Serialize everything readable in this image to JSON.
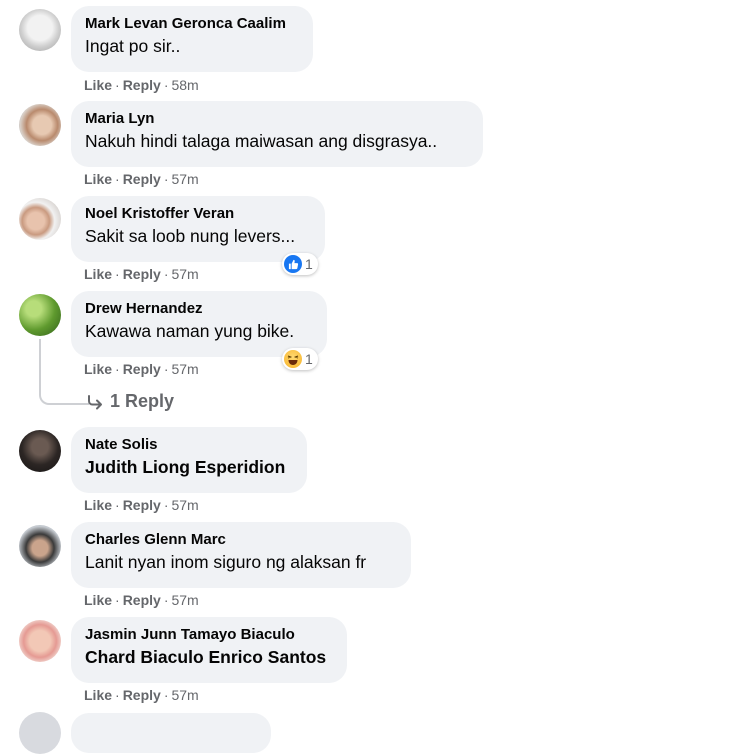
{
  "actions": {
    "like": "Like",
    "reply": "Reply",
    "sep": "·"
  },
  "comments": [
    {
      "author": "Mark Levan Geronca Caalim",
      "text": "Ingat po sir..",
      "time": "58m"
    },
    {
      "author": "Maria Lyn",
      "text": "Nakuh hindi talaga maiwasan ang disgrasya..",
      "time": "57m"
    },
    {
      "author": "Noel Kristoffer Veran",
      "text": "Sakit sa loob nung levers...",
      "time": "57m",
      "reaction": {
        "icon": "like-icon",
        "count": "1",
        "color": "#1877f2"
      }
    },
    {
      "author": "Drew Hernandez",
      "text": "Kawawa naman yung bike.",
      "time": "57m",
      "reaction": {
        "icon": "haha-icon",
        "count": "1",
        "color": "#f7b125"
      }
    },
    {
      "author": "Nate Solis",
      "text": "Judith Liong Esperidion",
      "time": "57m"
    },
    {
      "author": "Charles Glenn Marc",
      "text": "Lanit nyan inom siguro ng alaksan fr",
      "time": "57m"
    },
    {
      "author": "Jasmin Junn Tamayo Biaculo",
      "text": "Chard Biaculo Enrico Santos",
      "time": "57m"
    }
  ],
  "reply_link": "1 Reply",
  "colors": {
    "bubble": "#f0f2f5",
    "meta": "#65676b"
  }
}
